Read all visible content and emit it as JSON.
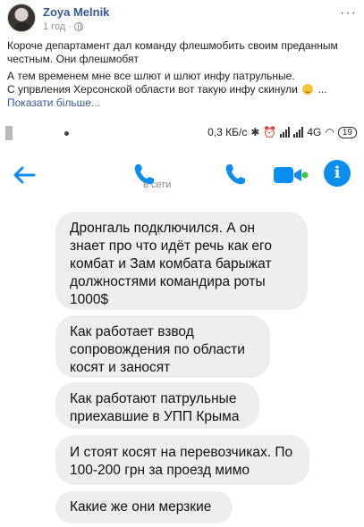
{
  "post": {
    "author": "Zoya Melnik",
    "time": "1 год",
    "separator": "·",
    "more": "···",
    "paragraph1": "Короче департамент дал команду флешмобить своим преданным честным. Они флешмобят",
    "paragraph2_line1": "А тем временем мне все шлют и шлют инфу патрульные.",
    "paragraph2_line2": "С упрвления Херсонской области вот такую инфу скинули",
    "ellipsis": "...",
    "see_more": "Показати більше..."
  },
  "phone_status": {
    "speed": "0,3 КБ/с",
    "network": "4G",
    "battery": "19"
  },
  "chat_header": {
    "status_text": "в сети"
  },
  "messages": [
    "Дронгаль подключился. А он знает про что идёт речь как его комбат и Зам комбата барыжат должностями командира роты 1000$",
    "Как работает взвод сопровождения по области косят и заносят",
    "Как работают патрульные приехавшие в УПП Крыма",
    "И стоят косят на перевозчиках. По 100-200 грн за проезд мимо",
    "Какие же они мерзкие"
  ],
  "colors": {
    "messenger_blue": "#0c8ef0",
    "bubble_bg": "#eeeeee",
    "facebook_link": "#385898"
  }
}
